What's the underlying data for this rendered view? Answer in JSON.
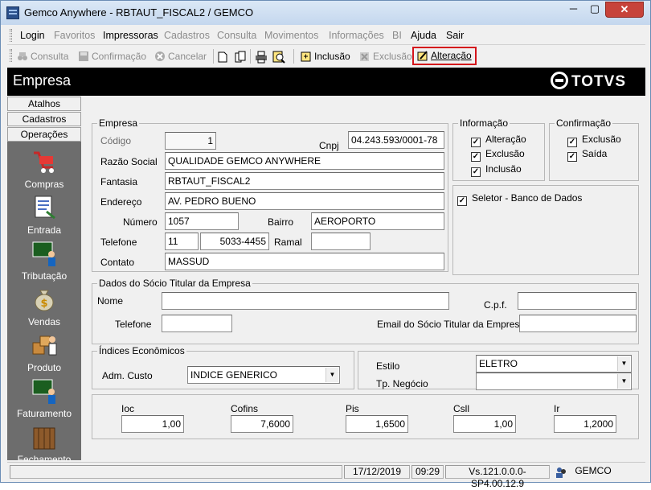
{
  "window": {
    "title": "Gemco Anywhere - RBTAUT_FISCAL2 / GEMCO",
    "min_label": "─",
    "max_label": "▢",
    "close_label": "✕"
  },
  "menu": [
    {
      "label": "Login",
      "enabled": true
    },
    {
      "label": "Favoritos",
      "enabled": false
    },
    {
      "label": "Impressoras",
      "enabled": true
    },
    {
      "label": "Cadastros",
      "enabled": false
    },
    {
      "label": "Consulta",
      "enabled": false
    },
    {
      "label": "Movimentos",
      "enabled": false
    },
    {
      "label": "Informações",
      "enabled": false
    },
    {
      "label": "BI",
      "enabled": false
    },
    {
      "label": "Ajuda",
      "enabled": true
    },
    {
      "label": "Sair",
      "enabled": true
    }
  ],
  "toolbar": {
    "consulta": "Consulta",
    "confirmacao": "Confirmação",
    "cancelar": "Cancelar",
    "inclusao": "Inclusão",
    "exclusao": "Exclusão",
    "alteracao": "Alteração",
    "highlight_color": "#d4141b"
  },
  "header": {
    "title": "Empresa",
    "brand": "TOTVS"
  },
  "sidebar": {
    "tabs": [
      "Atalhos",
      "Cadastros",
      "Operações"
    ],
    "items": [
      "Compras",
      "Entrada",
      "Tributação",
      "Vendas",
      "Produto",
      "Faturamento",
      "Fechamento"
    ]
  },
  "empresa": {
    "legend": "Empresa",
    "codigo_label": "Código",
    "codigo": "1",
    "cnpj_label": "Cnpj",
    "cnpj": "04.243.593/0001-78",
    "razao_label": "Razão Social",
    "razao": "QUALIDADE GEMCO ANYWHERE",
    "fantasia_label": "Fantasia",
    "fantasia": "RBTAUT_FISCAL2",
    "endereco_label": "Endereço",
    "endereco": "AV. PEDRO BUENO",
    "numero_label": "Número",
    "numero": "1057",
    "bairro_label": "Bairro",
    "bairro": "AEROPORTO",
    "telefone_label": "Telefone",
    "ddd": "11",
    "telefone": "5033-4455",
    "ramal_label": "Ramal",
    "ramal": "",
    "contato_label": "Contato",
    "contato": "MASSUD"
  },
  "informacao": {
    "legend": "Informação",
    "alteracao": "Alteração",
    "exclusao": "Exclusão",
    "inclusao": "Inclusão"
  },
  "confirmacao": {
    "legend": "Confirmação",
    "exclusao": "Exclusão",
    "saida": "Saída"
  },
  "seletor": {
    "label": "Seletor - Banco de Dados"
  },
  "check_mark": "✓",
  "socio": {
    "legend": "Dados do Sócio Titular da Empresa",
    "nome_label": "Nome",
    "nome": "",
    "cpf_label": "C.p.f.",
    "cpf": "",
    "telefone_label": "Telefone",
    "telefone": "",
    "email_label": "Email do Sócio Titular da Empresa",
    "email": ""
  },
  "indices": {
    "legend": "Índices Econômicos",
    "adm_label": "Adm. Custo",
    "adm_value": "INDICE GENERICO"
  },
  "estilo": {
    "estilo_label": "Estilo",
    "estilo_value": "ELETRO",
    "negocio_label": "Tp. Negócio",
    "negocio_value": ""
  },
  "impostos": {
    "ioc_label": "Ioc",
    "ioc": "1,00",
    "cofins_label": "Cofins",
    "cofins": "7,6000",
    "pis_label": "Pis",
    "pis": "1,6500",
    "csll_label": "Csll",
    "csll": "1,00",
    "ir_label": "Ir",
    "ir": "1,2000"
  },
  "status": {
    "date": "17/12/2019",
    "time": "09:29",
    "version": "Vs.121.0.0.0-SP4.00.12.9",
    "user": "GEMCO"
  }
}
